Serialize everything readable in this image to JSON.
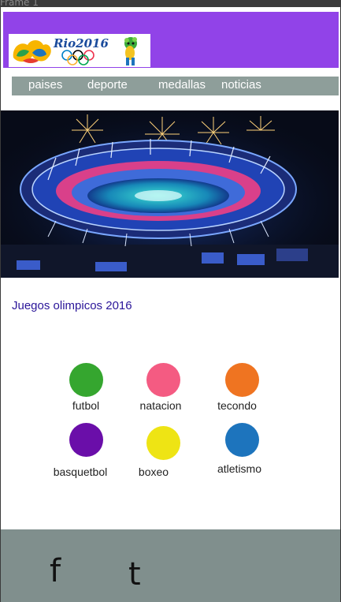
{
  "frame": {
    "label": "Frame 1"
  },
  "header": {
    "logo_text": "Rio2016"
  },
  "nav": {
    "items": [
      "paises",
      "deporte",
      "medallas",
      "noticias"
    ]
  },
  "main": {
    "title": "Juegos olimpicos 2016"
  },
  "sports": [
    {
      "label": "futbol",
      "color": "#35a62f"
    },
    {
      "label": "natacion",
      "color": "#f45b82"
    },
    {
      "label": "tecondo",
      "color": "#ef7421"
    },
    {
      "label": "basquetbol",
      "color": "#6a0ea9"
    },
    {
      "label": "boxeo",
      "color": "#eee414"
    },
    {
      "label": "atletismo",
      "color": "#1d74bd"
    }
  ],
  "footer": {
    "social": [
      "f",
      "t"
    ]
  }
}
